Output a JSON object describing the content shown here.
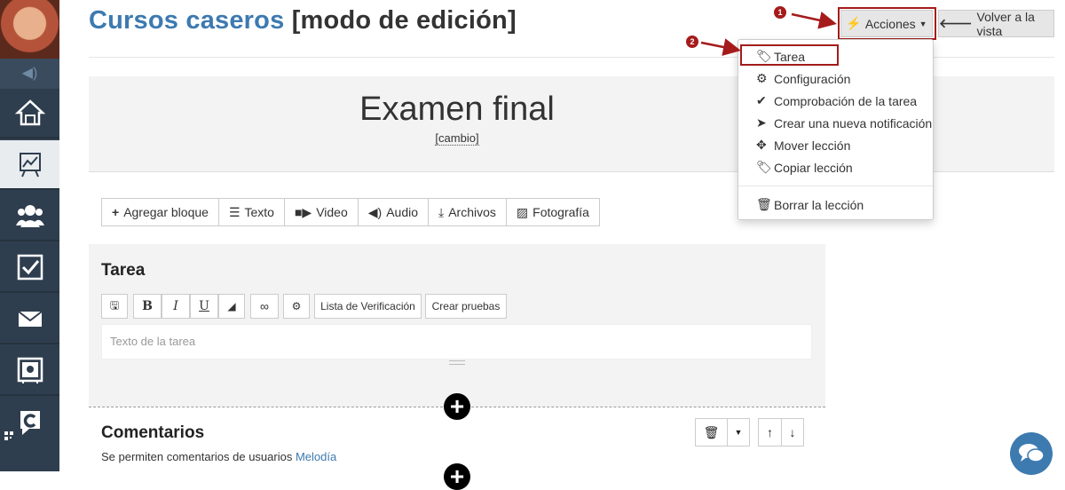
{
  "header": {
    "course_title": "Cursos caseros",
    "mode_label": "[modo de edición]",
    "actions_button": "Acciones",
    "back_button": "Volver a la vista"
  },
  "lesson": {
    "title": "Examen final",
    "change_link": "[cambio]"
  },
  "content_toolbar": {
    "add_block": "Agregar bloque",
    "text": "Texto",
    "video": "Video",
    "audio": "Audio",
    "files": "Archivos",
    "photo": "Fotografía"
  },
  "task_block": {
    "title": "Tarea",
    "checklist_button": "Lista de Verificación",
    "create_tests_button": "Crear pruebas",
    "editor_placeholder": "Texto de la tarea"
  },
  "comments_block": {
    "title": "Comentarios",
    "text_prefix": "Se permiten comentarios de usuarios",
    "text_link": "Melodía"
  },
  "actions_menu": {
    "items": [
      {
        "label": "Tarea",
        "icon": "tag-icon"
      },
      {
        "label": "Configuración",
        "icon": "gear-icon"
      },
      {
        "label": "Comprobación de la tarea",
        "icon": "check-icon"
      },
      {
        "label": "Crear una nueva notificación",
        "icon": "send-icon"
      },
      {
        "label": "Mover lección",
        "icon": "move-icon"
      },
      {
        "label": "Copiar lección",
        "icon": "tags-icon"
      },
      {
        "label": "Borrar la lección",
        "icon": "trash-icon"
      }
    ]
  },
  "annotations": {
    "badge_1": "1",
    "badge_2": "2",
    "highlight_color": "#a51b1b"
  },
  "colors": {
    "sidebar": "#2f3e4e",
    "accent": "#3d7ab0",
    "panel": "#f3f3f3"
  }
}
